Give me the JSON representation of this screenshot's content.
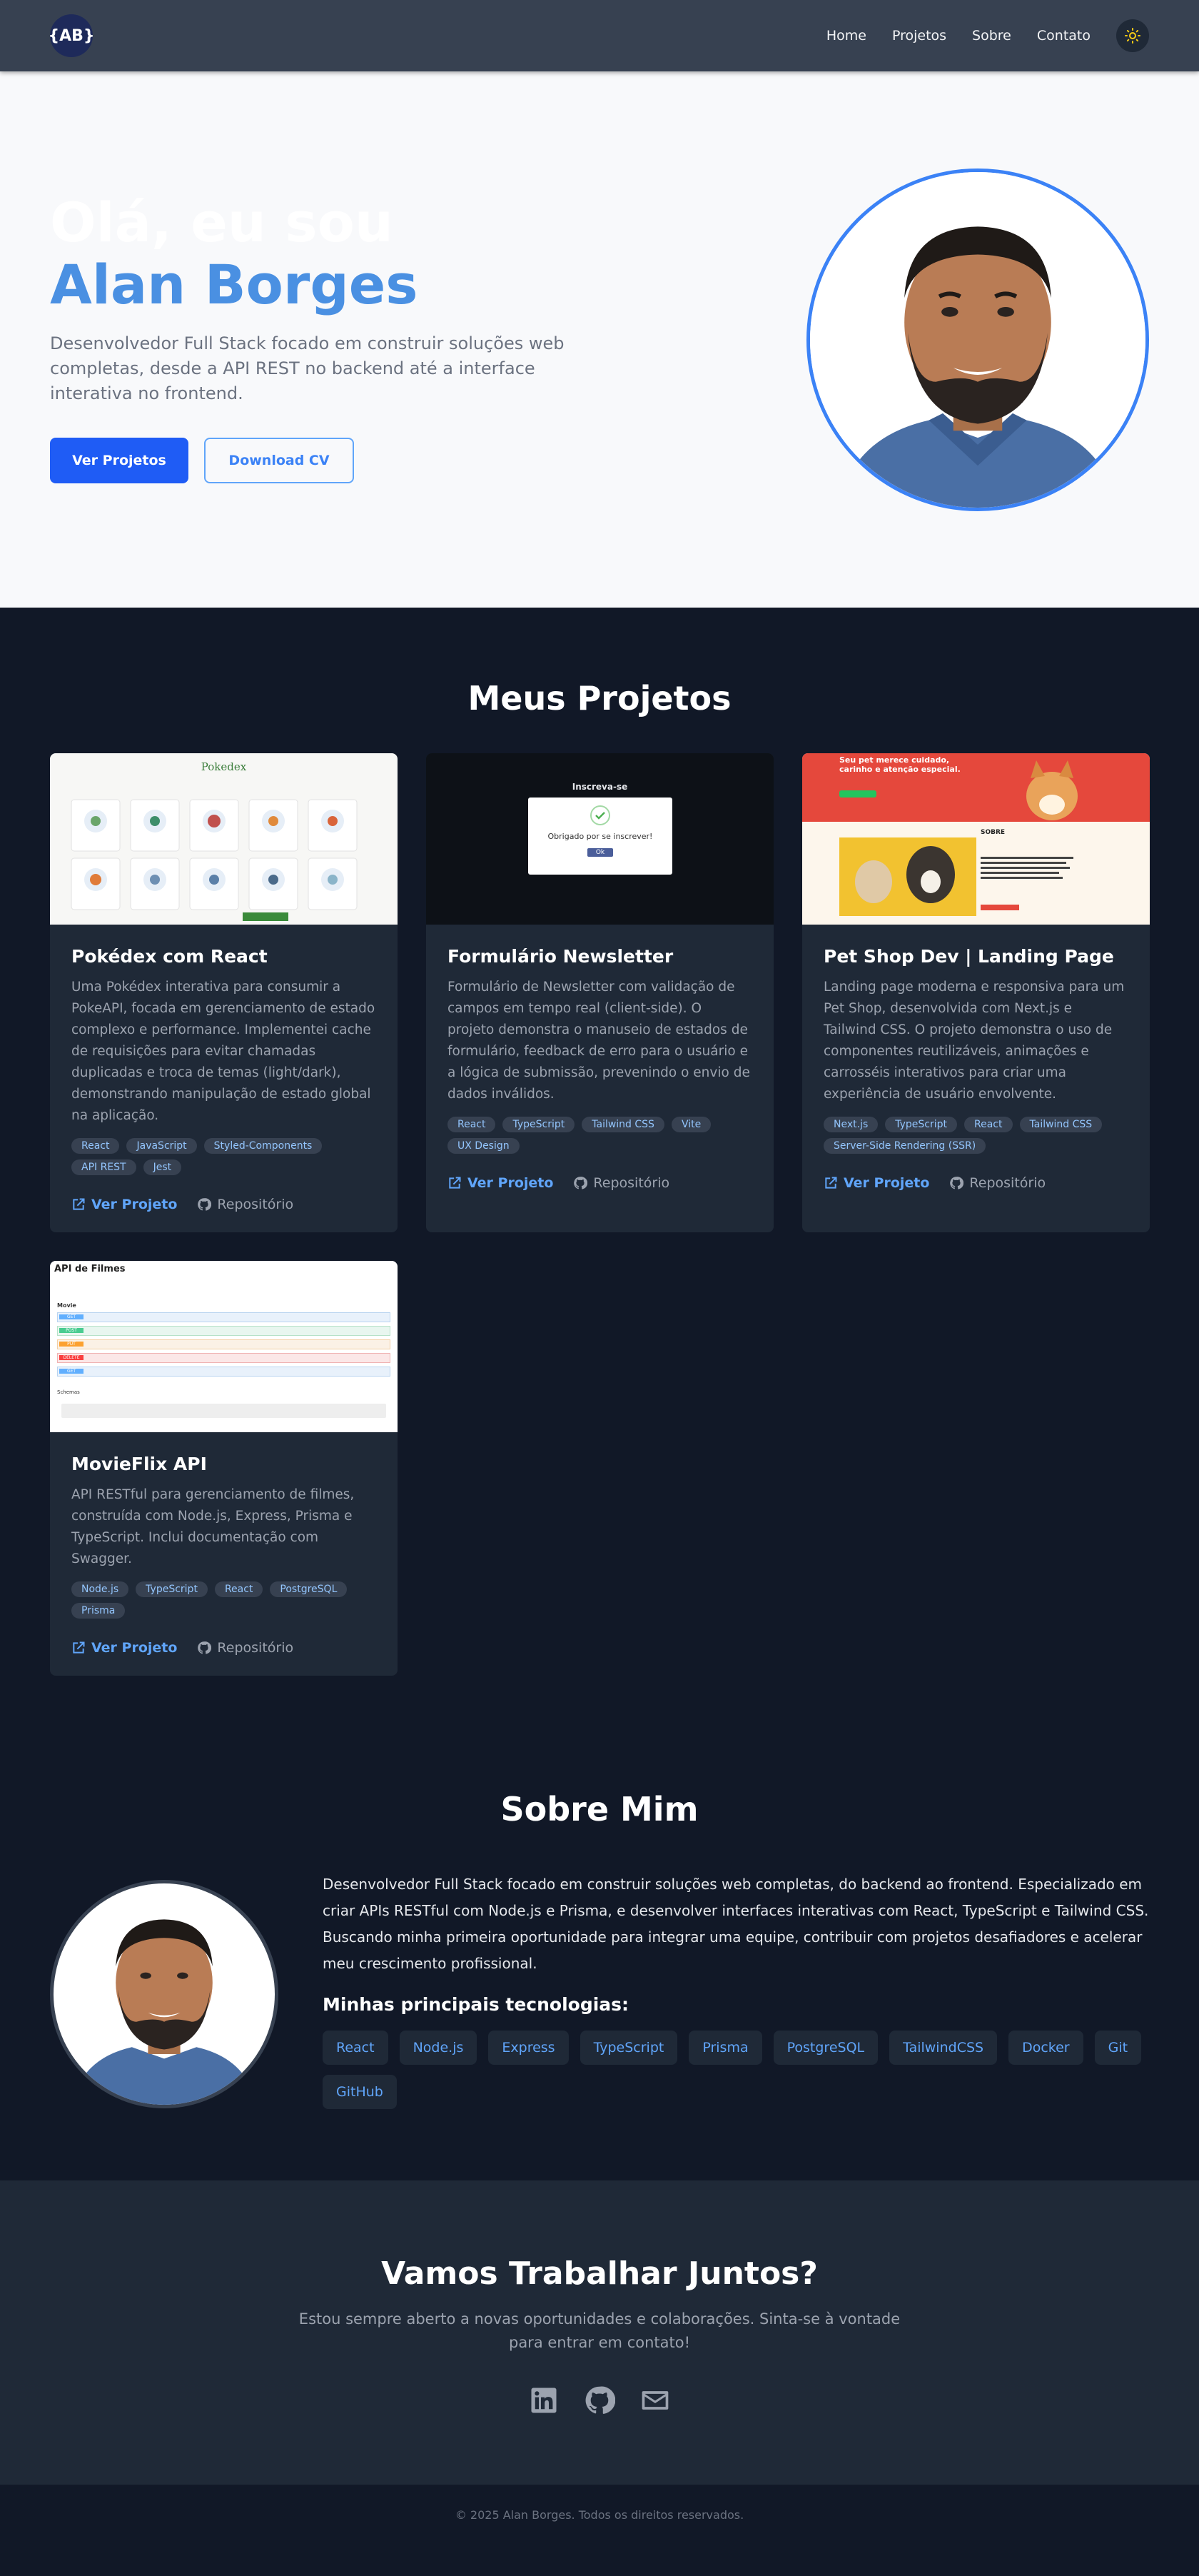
{
  "nav": {
    "logo": "{AB}",
    "links": [
      "Home",
      "Projetos",
      "Sobre",
      "Contato"
    ],
    "theme_icon": "sun-icon"
  },
  "hero": {
    "greeting": "Olá, eu sou",
    "name": "Alan Borges",
    "description": "Desenvolvedor Full Stack focado em construir soluções web completas, desde a API REST no backend até a interface interativa no frontend.",
    "primary_button": "Ver Projetos",
    "secondary_button": "Download CV"
  },
  "projects": {
    "title": "Meus Projetos",
    "live_label": "Ver Projeto",
    "repo_label": "Repositório",
    "items": [
      {
        "title": "Pokédex com React",
        "description": "Uma Pokédex interativa para consumir a PokeAPI, focada em gerenciamento de estado complexo e performance. Implementei cache de requisições para evitar chamadas duplicadas e troca de temas (light/dark), demonstrando manipulação de estado global na aplicação.",
        "tags": [
          "React",
          "JavaScript",
          "Styled-Components",
          "API REST",
          "Jest"
        ],
        "thumb_title": "Pokedex"
      },
      {
        "title": "Formulário Newsletter",
        "description": "Formulário de Newsletter com validação de campos em tempo real (client-side). O projeto demonstra o manuseio de estados de formulário, feedback de erro para o usuário e a lógica de submissão, prevenindo o envio de dados inválidos.",
        "tags": [
          "React",
          "TypeScript",
          "Tailwind CSS",
          "Vite",
          "UX Design"
        ],
        "thumb_title": "Inscreva-se",
        "thumb_message": "Obrigado por se inscrever!",
        "thumb_button": "Ok"
      },
      {
        "title": "Pet Shop Dev | Landing Page",
        "description": "Landing page moderna e responsiva para um Pet Shop, desenvolvida com Next.js e Tailwind CSS. O projeto demonstra o uso de componentes reutilizáveis, animações e carrosséis interativos para criar uma experiência de usuário envolvente.",
        "tags": [
          "Next.js",
          "TypeScript",
          "React",
          "Tailwind CSS",
          "Server-Side Rendering (SSR)"
        ],
        "thumb_heading": "Seu pet merece cuidado, carinho e atenção especial.",
        "thumb_section": "SOBRE"
      },
      {
        "title": "MovieFlix API",
        "description": "API RESTful para gerenciamento de filmes, construída com Node.js, Express, Prisma e TypeScript. Inclui documentação com Swagger.",
        "tags": [
          "Node.js",
          "TypeScript",
          "React",
          "PostgreSQL",
          "Prisma"
        ],
        "thumb_title": "API de Filmes",
        "thumb_group": "Movie",
        "thumb_group2": "Schemas",
        "thumb_methods": [
          "GET",
          "POST",
          "PUT",
          "DELETE",
          "GET"
        ]
      }
    ]
  },
  "about": {
    "title": "Sobre Mim",
    "text": "Desenvolvedor Full Stack focado em construir soluções web completas, do backend ao frontend. Especializado em criar APIs RESTful com Node.js e Prisma, e desenvolver interfaces interativas com React, TypeScript e Tailwind CSS. Buscando minha primeira oportunidade para integrar uma equipe, contribuir com projetos desafiadores e acelerar meu crescimento profissional.",
    "tech_title": "Minhas principais tecnologias:",
    "techs": [
      "React",
      "Node.js",
      "Express",
      "TypeScript",
      "Prisma",
      "PostgreSQL",
      "TailwindCSS",
      "Docker",
      "Git",
      "GitHub"
    ]
  },
  "contact": {
    "title": "Vamos Trabalhar Juntos?",
    "description": "Estou sempre aberto a novas oportunidades e colaborações. Sinta-se à vontade para entrar em contato!",
    "socials": [
      "linkedin-icon",
      "github-icon",
      "mail-icon"
    ]
  },
  "footer": {
    "text": "© 2025 Alan Borges. Todos os direitos reservados."
  },
  "colors": {
    "accent": "#3b82f6",
    "primary_button": "#1f5cf5",
    "background_dark": "#111827",
    "card": "#1f2937"
  }
}
